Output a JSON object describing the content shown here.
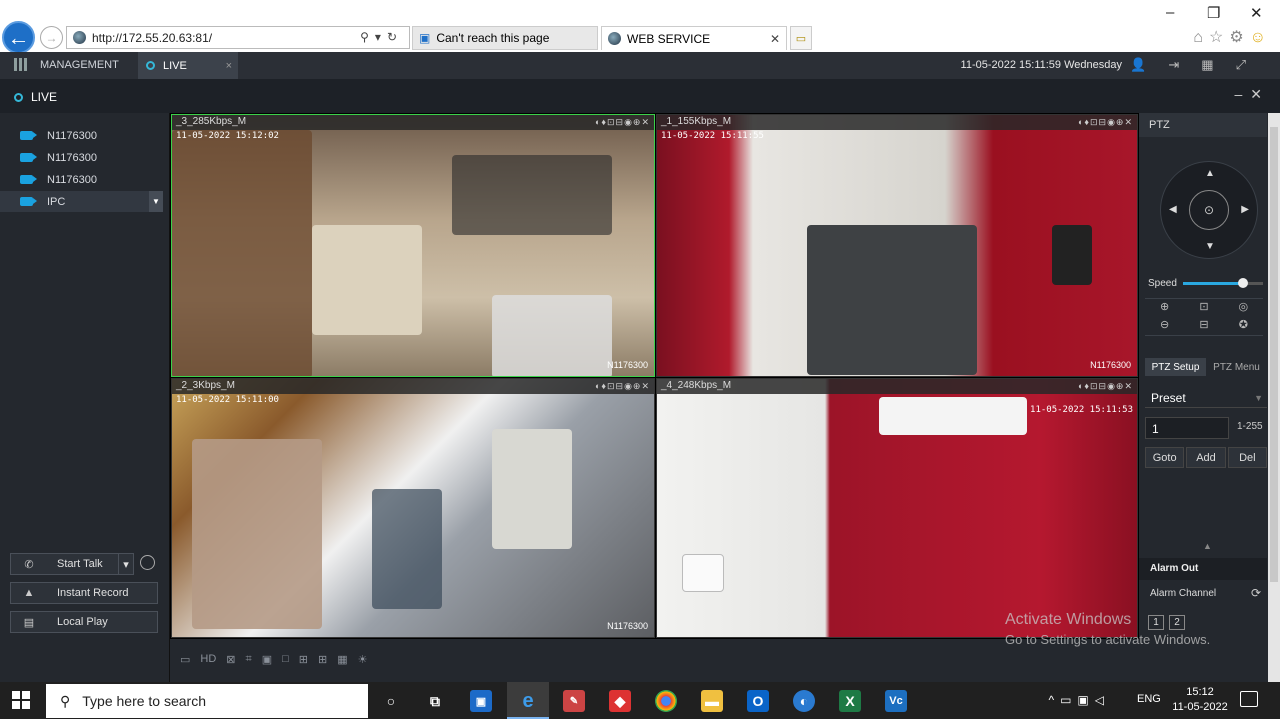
{
  "browser": {
    "url": "http://172.55.20.63:81/",
    "tabs": [
      {
        "label": "Can't reach this page"
      },
      {
        "label": "WEB SERVICE"
      }
    ],
    "window_controls": [
      "–",
      "❐",
      "✕"
    ]
  },
  "app": {
    "management_label": "MANAGEMENT",
    "live_tab_label": "LIVE",
    "datetime": "11-05-2022 15:11:59 Wednesday",
    "page_title": "LIVE"
  },
  "devices": [
    {
      "label": "N1176300"
    },
    {
      "label": "N1176300"
    },
    {
      "label": "N1176300"
    },
    {
      "label": "IPC"
    }
  ],
  "left_buttons": {
    "start_talk": "Start Talk",
    "instant_record": "Instant Record",
    "local_play": "Local Play"
  },
  "tiles": [
    {
      "header": "_3_285Kbps_M",
      "timestamp": "11-05-2022 15:12:02",
      "watermark": "N1176300"
    },
    {
      "header": "_1_155Kbps_M",
      "timestamp": "11-05-2022 15:11:55",
      "watermark": "N1176300"
    },
    {
      "header": "_2_3Kbps_M",
      "timestamp": "11-05-2022 15:11:00",
      "watermark": "N1176300"
    },
    {
      "header": "_4_248Kbps_M",
      "timestamp": "11-05-2022 15:11:53",
      "watermark": ""
    }
  ],
  "bottom_toolbar": {
    "hd_label": "HD"
  },
  "ptz": {
    "title": "PTZ",
    "speed_label": "Speed",
    "speed_level": 0.75,
    "tab_setup": "PTZ Setup",
    "tab_menu": "PTZ Menu",
    "preset_label": "Preset",
    "preset_value": "1",
    "preset_range": "1-255",
    "goto": "Goto",
    "add": "Add",
    "del": "Del"
  },
  "alarm": {
    "header": "Alarm Out",
    "channel_label": "Alarm Channel",
    "channels": [
      "1",
      "2"
    ]
  },
  "watermark_windows": {
    "line1": "Activate Windows",
    "line2": "Go to Settings to activate Windows."
  },
  "taskbar": {
    "search_placeholder": "Type here to search",
    "language": "ENG",
    "time": "15:12",
    "date": "11-05-2022"
  },
  "colors": {
    "accent": "#1aa2e0",
    "selected_tile_border": "#3bd14a",
    "panel_bg": "#24282e"
  }
}
